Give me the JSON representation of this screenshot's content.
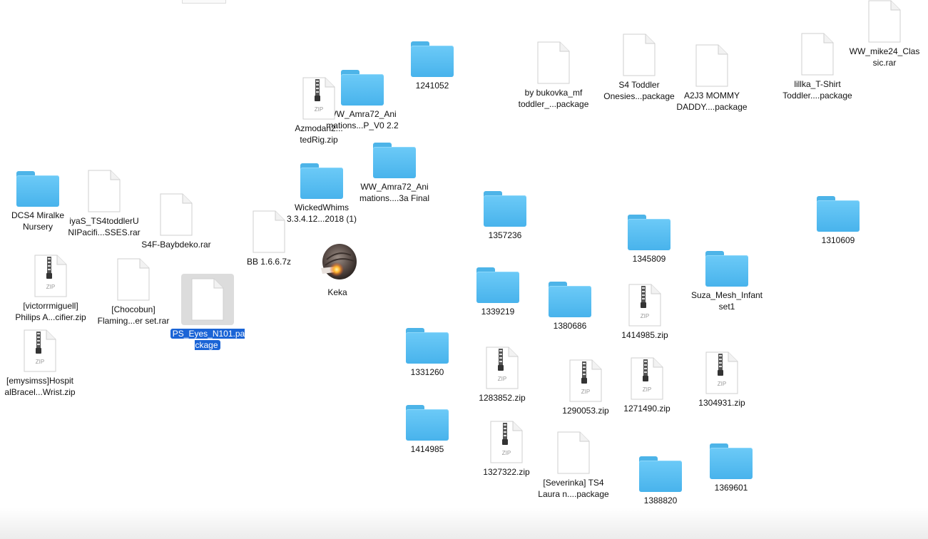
{
  "items": [
    {
      "id": "f1",
      "type": "folder",
      "label": "1241052"
    },
    {
      "id": "f2",
      "type": "folder",
      "label": "WW_Amra72_Ani\nmations...P_V0 2.2"
    },
    {
      "id": "f3",
      "type": "folder",
      "label": "WW_Amra72_Ani\nmations....3a Final"
    },
    {
      "id": "f4",
      "type": "folder",
      "label": "WickedWhims\n3.3.4.12...2018 (1)"
    },
    {
      "id": "f5",
      "type": "folder",
      "label": "DCS4 Miralke\nNursery"
    },
    {
      "id": "f6",
      "type": "folder",
      "label": "1357236"
    },
    {
      "id": "f7",
      "type": "folder",
      "label": "1345809"
    },
    {
      "id": "f8",
      "type": "folder",
      "label": "1310609"
    },
    {
      "id": "f9",
      "type": "folder",
      "label": "1339219"
    },
    {
      "id": "f10",
      "type": "folder",
      "label": "1380686"
    },
    {
      "id": "f11",
      "type": "folder",
      "label": "Suza_Mesh_Infant\nset1"
    },
    {
      "id": "f12",
      "type": "folder",
      "label": "1331260"
    },
    {
      "id": "f13",
      "type": "folder",
      "label": "1414985"
    },
    {
      "id": "f14",
      "type": "folder",
      "label": "1388820"
    },
    {
      "id": "f15",
      "type": "folder",
      "label": "1369601"
    },
    {
      "id": "d1",
      "type": "doc",
      "label": "by bukovka_mf\ntoddler_...package"
    },
    {
      "id": "d2",
      "type": "doc",
      "label": "S4 Toddler\nOnesies...package"
    },
    {
      "id": "d3",
      "type": "doc",
      "label": "A2J3 MOMMY\nDADDY....package"
    },
    {
      "id": "d4",
      "type": "doc",
      "label": "lillka_T-Shirt\nToddler....package"
    },
    {
      "id": "d5",
      "type": "doc",
      "label": "WW_mike24_Clas\nsic.rar"
    },
    {
      "id": "d6",
      "type": "doc",
      "label": "iyaS_TS4toddlerU\nNIPacifi...SSES.rar"
    },
    {
      "id": "d7",
      "type": "doc",
      "label": "S4F-Baybdeko.rar"
    },
    {
      "id": "d8",
      "type": "doc",
      "label": "BB 1.6.6.7z"
    },
    {
      "id": "d9",
      "type": "doc",
      "label": "[Chocobun]\nFlaming...er set.rar"
    },
    {
      "id": "d10",
      "type": "doc",
      "label": "PS_Eyes_N101.pa\nckage",
      "selected": true
    },
    {
      "id": "d11",
      "type": "doc",
      "label": "[Severinka] TS4\nLaura n....package"
    },
    {
      "id": "z1",
      "type": "zip",
      "label": "Azmodan2...\ntedRig.zip"
    },
    {
      "id": "z2",
      "type": "zip",
      "label": "[victorrmiguell]\nPhilips A...cifier.zip"
    },
    {
      "id": "z3",
      "type": "zip",
      "label": "[emysimss]Hospit\nalBracel...Wrist.zip"
    },
    {
      "id": "z4",
      "type": "zip",
      "label": "1414985.zip"
    },
    {
      "id": "z5",
      "type": "zip",
      "label": "1283852.zip"
    },
    {
      "id": "z6",
      "type": "zip",
      "label": "1290053.zip"
    },
    {
      "id": "z7",
      "type": "zip",
      "label": "1271490.zip"
    },
    {
      "id": "z8",
      "type": "zip",
      "label": "1304931.zip"
    },
    {
      "id": "z9",
      "type": "zip",
      "label": "1327322.zip"
    },
    {
      "id": "a1",
      "type": "app",
      "label": "Keka"
    }
  ],
  "zip_badge": "ZIP",
  "colors": {
    "folder": "#5bbff3",
    "selection": "#1a64d6"
  }
}
